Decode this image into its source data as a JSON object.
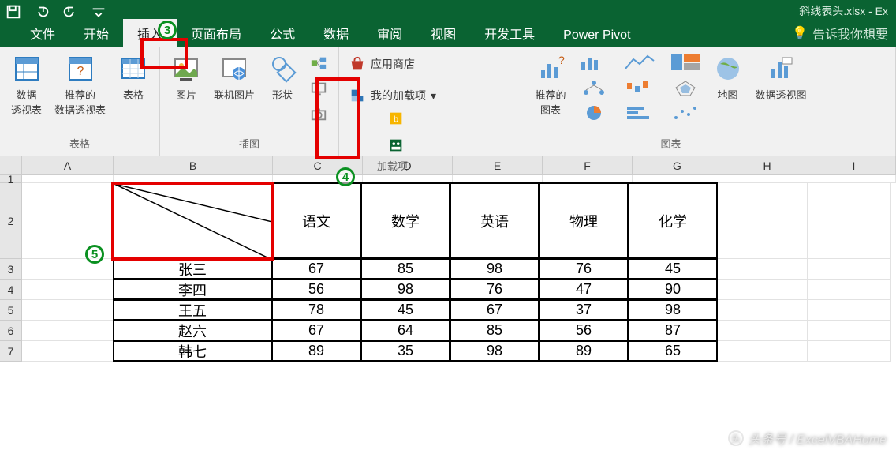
{
  "title": "斜线表头.xlsx - Ex",
  "tabs": {
    "file": "文件",
    "home": "开始",
    "insert": "插入",
    "layout": "页面布局",
    "formula": "公式",
    "data": "数据",
    "review": "审阅",
    "view": "视图",
    "dev": "开发工具",
    "pp": "Power Pivot",
    "tellme": "告诉我你想要"
  },
  "ribbon": {
    "tables": {
      "pivot": "数据\n透视表",
      "recpivot": "推荐的\n数据透视表",
      "table": "表格",
      "label": "表格"
    },
    "illus": {
      "pic": "图片",
      "olpic": "联机图片",
      "shapes": "形状",
      "label": "插图"
    },
    "addins": {
      "store": "应用商店",
      "myaddins": "我的加载项",
      "label": "加载项"
    },
    "charts": {
      "rec": "推荐的\n图表",
      "map": "地图",
      "pchart": "数据透视图",
      "label": "图表"
    }
  },
  "cols": [
    "A",
    "B",
    "C",
    "D",
    "E",
    "F",
    "G",
    "H",
    "I"
  ],
  "rows": [
    "1",
    "2",
    "3",
    "4",
    "5",
    "6",
    "7"
  ],
  "table": {
    "headers": [
      "语文",
      "数学",
      "英语",
      "物理",
      "化学"
    ],
    "rows": [
      {
        "name": "张三",
        "vals": [
          67,
          85,
          98,
          76,
          45
        ]
      },
      {
        "name": "李四",
        "vals": [
          56,
          98,
          76,
          47,
          90
        ]
      },
      {
        "name": "王五",
        "vals": [
          78,
          45,
          67,
          37,
          98
        ]
      },
      {
        "name": "赵六",
        "vals": [
          67,
          64,
          85,
          56,
          87
        ]
      },
      {
        "name": "韩七",
        "vals": [
          89,
          35,
          98,
          89,
          65
        ]
      }
    ]
  },
  "annotations": {
    "n3": "3",
    "n4": "4",
    "n5": "5"
  },
  "watermark": "头条号 / ExcelVBAHome"
}
